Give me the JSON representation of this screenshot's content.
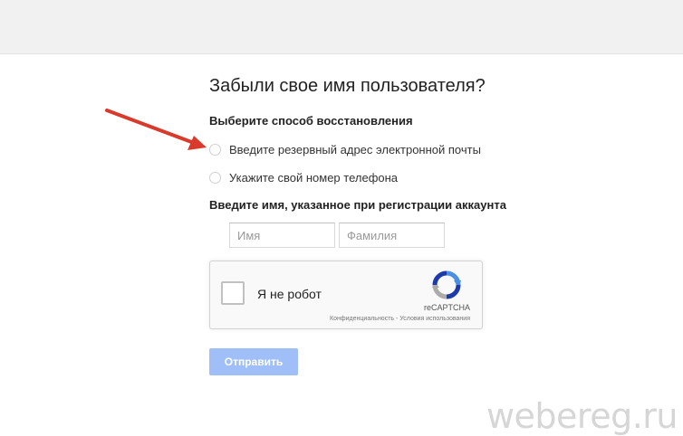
{
  "page": {
    "title": "Забыли свое имя пользователя?",
    "recovery_label": "Выберите способ восстановления",
    "options": [
      {
        "label": "Введите резервный адрес электронной почты"
      },
      {
        "label": "Укажите свой номер телефона"
      }
    ],
    "name_label": "Введите имя, указанное при регистрации аккаунта",
    "first_name_placeholder": "Имя",
    "last_name_placeholder": "Фамилия",
    "recaptcha": {
      "label": "Я не робот",
      "brand": "reCAPTCHA",
      "privacy_link": "Конфиденциальность",
      "separator": " - ",
      "terms_link": "Условия использования"
    },
    "submit_label": "Отправить",
    "watermark": "webereg.ru"
  },
  "colors": {
    "submit_bg": "#a0bff8",
    "arrow": "#d93a2b",
    "recaptcha_blue": "#1c3aa9",
    "recaptcha_light_blue": "#4a90e2",
    "recaptcha_gray": "#ababab"
  },
  "icons": {
    "arrow": "red-annotation-arrow-icon",
    "recaptcha": "recaptcha-logo-icon"
  }
}
